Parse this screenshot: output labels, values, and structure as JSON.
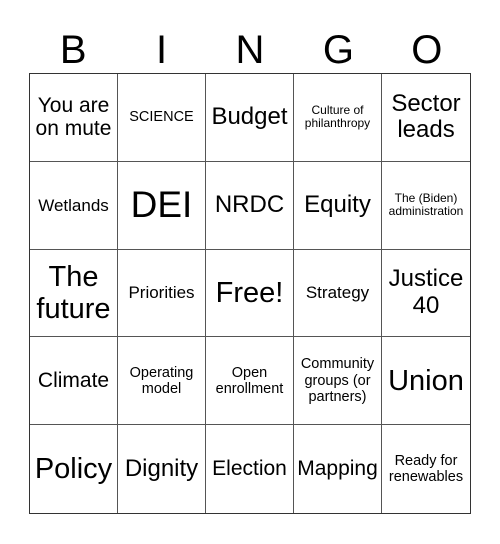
{
  "header": {
    "letters": [
      "B",
      "I",
      "N",
      "G",
      "O"
    ]
  },
  "board": {
    "cells": [
      {
        "text": "You are on mute",
        "size": "lg"
      },
      {
        "text": "SCIENCE",
        "size": "sm"
      },
      {
        "text": "Budget",
        "size": "xl"
      },
      {
        "text": "Culture of philanthropy",
        "size": "xs"
      },
      {
        "text": "Sector leads",
        "size": "xl"
      },
      {
        "text": "Wetlands",
        "size": "md"
      },
      {
        "text": "DEI",
        "size": "huge"
      },
      {
        "text": "NRDC",
        "size": "xl"
      },
      {
        "text": "Equity",
        "size": "xl"
      },
      {
        "text": "The (Biden) administration",
        "size": "xs"
      },
      {
        "text": "The future",
        "size": "xxl"
      },
      {
        "text": "Priorities",
        "size": "md"
      },
      {
        "text": "Free!",
        "size": "xxl"
      },
      {
        "text": "Strategy",
        "size": "md"
      },
      {
        "text": "Justice 40",
        "size": "xl"
      },
      {
        "text": "Climate",
        "size": "lg"
      },
      {
        "text": "Operating model",
        "size": "sm"
      },
      {
        "text": "Open enrollment",
        "size": "sm"
      },
      {
        "text": "Community groups (or partners)",
        "size": "sm"
      },
      {
        "text": "Union",
        "size": "xxl"
      },
      {
        "text": "Policy",
        "size": "xxl"
      },
      {
        "text": "Dignity",
        "size": "xl"
      },
      {
        "text": "Election",
        "size": "lg"
      },
      {
        "text": "Mapping",
        "size": "lg"
      },
      {
        "text": "Ready for renewables",
        "size": "sm"
      }
    ]
  }
}
